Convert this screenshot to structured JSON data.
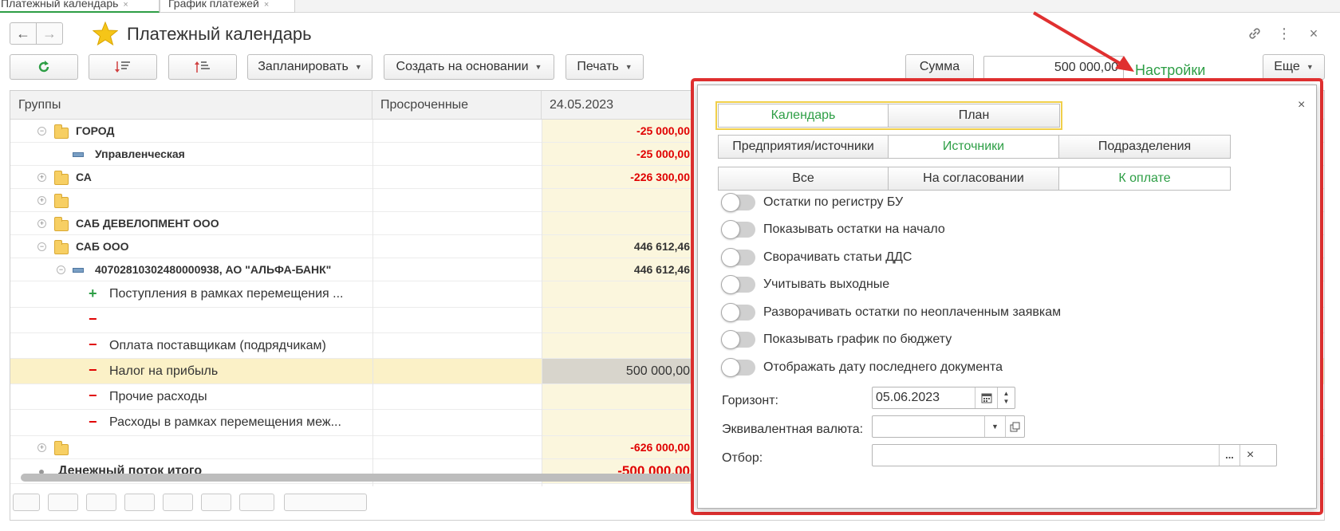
{
  "tabs": [
    {
      "label": "Платежный календарь",
      "close": "×"
    },
    {
      "label": "График платежей",
      "close": "×"
    }
  ],
  "header": {
    "title": "Платежный календарь",
    "back": "←",
    "forward": "→",
    "link_icon": "🔗",
    "more_icon": "⋮",
    "close_icon": "×"
  },
  "toolbar": {
    "refresh": "↻",
    "sort_desc": "↓≡",
    "sort_asc": "↑≡",
    "plan": "Запланировать",
    "create_based": "Создать на основании",
    "print": "Печать",
    "sum_label": "Сумма",
    "sum_value": "500 000,00",
    "settings": "Настройки",
    "more": "Еще",
    "caret": "▼"
  },
  "table": {
    "columns": [
      "Группы",
      "Просроченные",
      "24.05.2023"
    ],
    "rows": [
      {
        "kind": "group",
        "level": 1,
        "expand": "−",
        "label": "ГОРОД",
        "amount": "-25 000,00",
        "red": true
      },
      {
        "kind": "account",
        "level": 2,
        "label": "Управленческая",
        "amount": "-25 000,00",
        "red": true
      },
      {
        "kind": "group",
        "level": 1,
        "expand": "+",
        "label": "СА",
        "amount": "-226 300,00",
        "red": true
      },
      {
        "kind": "group",
        "level": 1,
        "expand": "+",
        "label": "",
        "amount": "",
        "red": false
      },
      {
        "kind": "group",
        "level": 1,
        "expand": "+",
        "label": "САБ ДЕВЕЛОПМЕНТ ООО",
        "amount": "",
        "red": false
      },
      {
        "kind": "group",
        "level": 1,
        "expand": "−",
        "label": "САБ ООО",
        "amount": "446 612,46",
        "red": false
      },
      {
        "kind": "account",
        "level": 2,
        "expand": "−",
        "label": "40702810302480000938, АО \"АЛЬФА-БАНК\"",
        "amount": "446 612,46",
        "red": false
      },
      {
        "kind": "plus",
        "label": "Поступления в рамках перемещения ...",
        "amount": ""
      },
      {
        "kind": "minus",
        "label": "",
        "amount": ""
      },
      {
        "kind": "minus",
        "label": "Оплата поставщикам (подрядчикам)",
        "amount": ""
      },
      {
        "kind": "minus",
        "label": "Налог на прибыль",
        "amount": "500 000,00",
        "selected": true
      },
      {
        "kind": "minus",
        "label": "Прочие расходы",
        "amount": ""
      },
      {
        "kind": "minus",
        "label": "Расходы в рамках перемещения меж...",
        "amount": ""
      },
      {
        "kind": "group",
        "level": 1,
        "expand": "+",
        "label": "",
        "amount": "-626 000,00",
        "red": true
      },
      {
        "kind": "total",
        "label": "Денежный поток итого",
        "amount": "-500 000,00",
        "red": true
      }
    ]
  },
  "settings": {
    "close": "×",
    "view_mode": [
      {
        "label": "Календарь",
        "active": true
      },
      {
        "label": "План",
        "active": false
      }
    ],
    "source_mode": [
      {
        "label": "Предприятия/источники",
        "active": false
      },
      {
        "label": "Источники",
        "active": true
      },
      {
        "label": "Подразделения",
        "active": false
      }
    ],
    "status_mode": [
      {
        "label": "Все",
        "active": false
      },
      {
        "label": "На согласовании",
        "active": false
      },
      {
        "label": "К оплате",
        "active": true
      }
    ],
    "toggles": [
      {
        "label": "Остатки по регистру БУ",
        "on": false
      },
      {
        "label": "Показывать остатки на начало",
        "on": false
      },
      {
        "label": "Сворачивать статьи ДДС",
        "on": false
      },
      {
        "label": "Учитывать выходные",
        "on": false
      },
      {
        "label": "Разворачивать остатки по неоплаченным заявкам",
        "on": false
      },
      {
        "label": "Показывать график по бюджету",
        "on": false
      },
      {
        "label": "Отображать дату последнего документа",
        "on": false
      }
    ],
    "horizon_label": "Горизонт:",
    "horizon_value": "05.06.2023",
    "currency_label": "Эквивалентная валюта:",
    "currency_value": "",
    "filter_label": "Отбор:",
    "filter_value": "",
    "ellipsis": "...",
    "clear": "×"
  },
  "colors": {
    "accent": "#2d9e45",
    "negative": "#e00000",
    "highlight": "#e03030",
    "selected_row": "#fbf1c7"
  }
}
